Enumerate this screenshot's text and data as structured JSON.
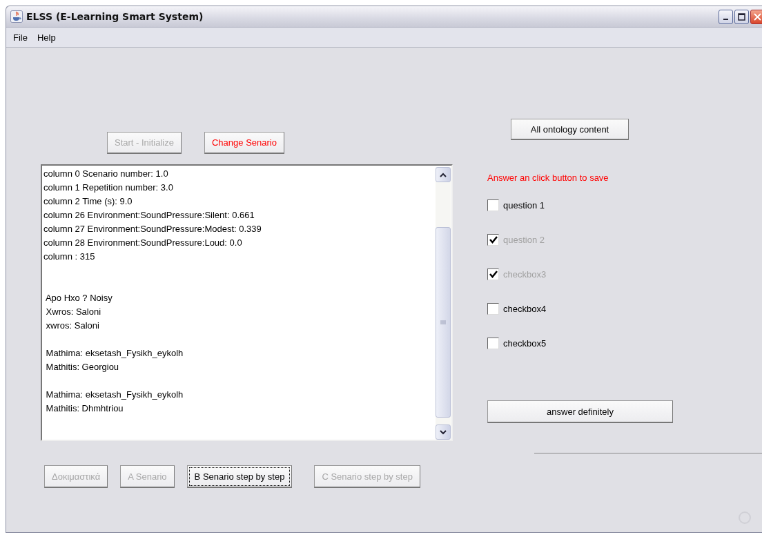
{
  "window": {
    "title": "ELSS (E-Learning Smart System)"
  },
  "menu": [
    "File",
    "Help"
  ],
  "top_buttons": [
    {
      "label": "Start - Initialize",
      "disabled": true,
      "kind": "normal"
    },
    {
      "label": "Change Senario",
      "disabled": false,
      "kind": "alert"
    }
  ],
  "log_blocks": [
    {
      "lines": [
        "column 0 Scenario number: 1.0",
        "column 1 Repetition number: 3.0",
        "column 2 Time (s): 9.0",
        "column 26 Environment:SoundPressure:Silent: 0.661",
        "column 27 Environment:SoundPressure:Modest: 0.339",
        "column 28 Environment:SoundPressure:Loud: 0.0",
        "column : 315"
      ]
    },
    {
      "lines": [
        " Apo Hxo ? Noisy",
        " Xwros: Saloni",
        " xwros: Saloni"
      ]
    },
    {
      "lines": [
        " Mathima: eksetash_Fysikh_eykolh",
        " Mathitis: Georgiou"
      ]
    },
    {
      "lines": [
        " Mathima: eksetash_Fysikh_eykolh",
        " Mathitis: Dhmhtriou"
      ]
    }
  ],
  "bottom_buttons": [
    {
      "label": "Δοκιμαστικά",
      "disabled": true,
      "focused": false
    },
    {
      "label": "A  Senario",
      "disabled": true,
      "focused": false
    },
    {
      "label": "B  Senario step by step",
      "disabled": false,
      "focused": true
    },
    {
      "label": "C  Senario step by step",
      "disabled": true,
      "focused": false
    }
  ],
  "ontology_button": {
    "label": "All ontology content"
  },
  "instruction": "Answer an click button to save",
  "checkboxes": [
    {
      "label": "question 1",
      "checked": false,
      "disabled": false
    },
    {
      "label": "question 2",
      "checked": true,
      "disabled": true
    },
    {
      "label": "checkbox3",
      "checked": true,
      "disabled": true
    },
    {
      "label": "checkbox4",
      "checked": false,
      "disabled": false
    },
    {
      "label": "checkbox5",
      "checked": false,
      "disabled": false
    }
  ],
  "answer_button": {
    "label": "answer definitely"
  }
}
